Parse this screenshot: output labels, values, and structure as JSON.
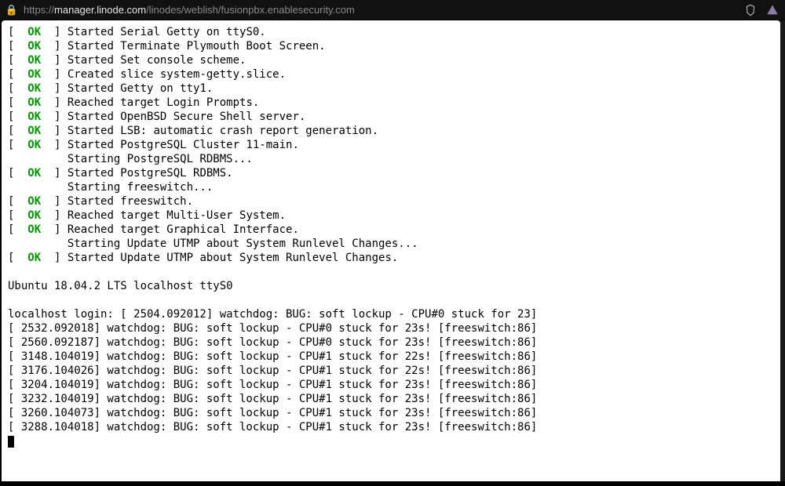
{
  "address_bar": {
    "scheme": "https://",
    "host": "manager.linode.com",
    "path": "/linodes/weblish/fusionpbx.enablesecurity.com",
    "lock_icon": "🔒",
    "ext1_name": "brave-shield-icon",
    "ext2_name": "extension-icon"
  },
  "boot": {
    "ok_label": "OK",
    "lines": [
      {
        "ok": true,
        "text": "Started Serial Getty on ttyS0."
      },
      {
        "ok": true,
        "text": "Started Terminate Plymouth Boot Screen."
      },
      {
        "ok": true,
        "text": "Started Set console scheme."
      },
      {
        "ok": true,
        "text": "Created slice system-getty.slice."
      },
      {
        "ok": true,
        "text": "Started Getty on tty1."
      },
      {
        "ok": true,
        "text": "Reached target Login Prompts."
      },
      {
        "ok": true,
        "text": "Started OpenBSD Secure Shell server."
      },
      {
        "ok": true,
        "text": "Started LSB: automatic crash report generation."
      },
      {
        "ok": true,
        "text": "Started PostgreSQL Cluster 11-main."
      },
      {
        "ok": false,
        "text": "Starting PostgreSQL RDBMS..."
      },
      {
        "ok": true,
        "text": "Started PostgreSQL RDBMS."
      },
      {
        "ok": false,
        "text": "Starting freeswitch..."
      },
      {
        "ok": true,
        "text": "Started freeswitch."
      },
      {
        "ok": true,
        "text": "Reached target Multi-User System."
      },
      {
        "ok": true,
        "text": "Reached target Graphical Interface."
      },
      {
        "ok": false,
        "text": "Starting Update UTMP about System Runlevel Changes..."
      },
      {
        "ok": true,
        "text": "Started Update UTMP about System Runlevel Changes."
      }
    ],
    "blank": "",
    "banner": "Ubuntu 18.04.2 LTS localhost ttyS0",
    "login_prompt": "localhost login: ",
    "watchdog_first": "[ 2504.092012] watchdog: BUG: soft lockup - CPU#0 stuck for 23]",
    "watchdog": [
      "[ 2532.092018] watchdog: BUG: soft lockup - CPU#0 stuck for 23s! [freeswitch:86]",
      "[ 2560.092187] watchdog: BUG: soft lockup - CPU#0 stuck for 23s! [freeswitch:86]",
      "[ 3148.104019] watchdog: BUG: soft lockup - CPU#1 stuck for 22s! [freeswitch:86]",
      "[ 3176.104026] watchdog: BUG: soft lockup - CPU#1 stuck for 22s! [freeswitch:86]",
      "[ 3204.104019] watchdog: BUG: soft lockup - CPU#1 stuck for 23s! [freeswitch:86]",
      "[ 3232.104019] watchdog: BUG: soft lockup - CPU#1 stuck for 23s! [freeswitch:86]",
      "[ 3260.104073] watchdog: BUG: soft lockup - CPU#1 stuck for 23s! [freeswitch:86]",
      "[ 3288.104018] watchdog: BUG: soft lockup - CPU#1 stuck for 23s! [freeswitch:86]"
    ]
  }
}
